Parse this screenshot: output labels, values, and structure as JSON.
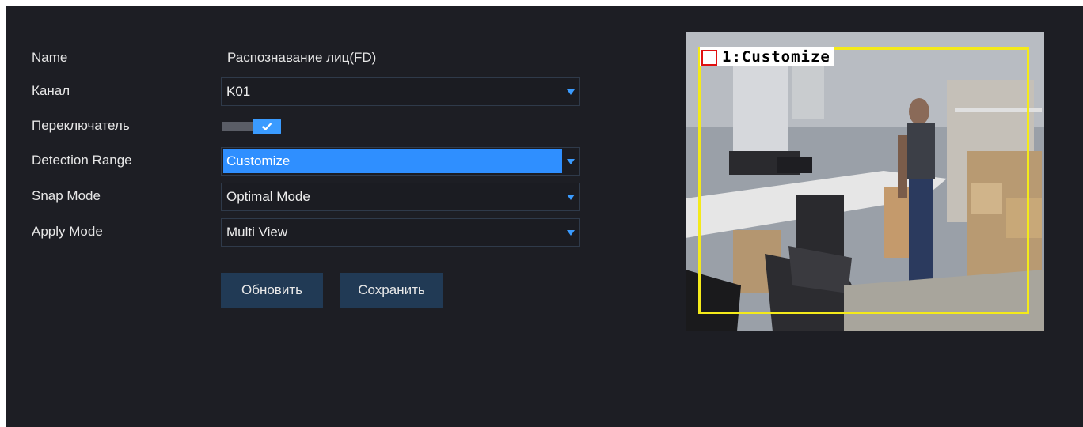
{
  "form": {
    "name_label": "Name",
    "name_value": "Распознавание лиц(FD)",
    "channel_label": "Канал",
    "channel_value": "K01",
    "switch_label": "Переключатель",
    "switch_state": "on",
    "detection_range_label": "Detection Range",
    "detection_range_value": "Customize",
    "snap_mode_label": "Snap Mode",
    "snap_mode_value": "Optimal Mode",
    "apply_mode_label": "Apply Mode",
    "apply_mode_value": "Multi View"
  },
  "buttons": {
    "refresh_label": "Обновить",
    "save_label": "Сохранить"
  },
  "preview": {
    "osd_text": "1:Customize"
  },
  "colors": {
    "background": "#1d1e24",
    "accent": "#3a9bff",
    "button": "#213a55",
    "roi": "#f4ea1a",
    "osd_marker": "#e01010"
  }
}
